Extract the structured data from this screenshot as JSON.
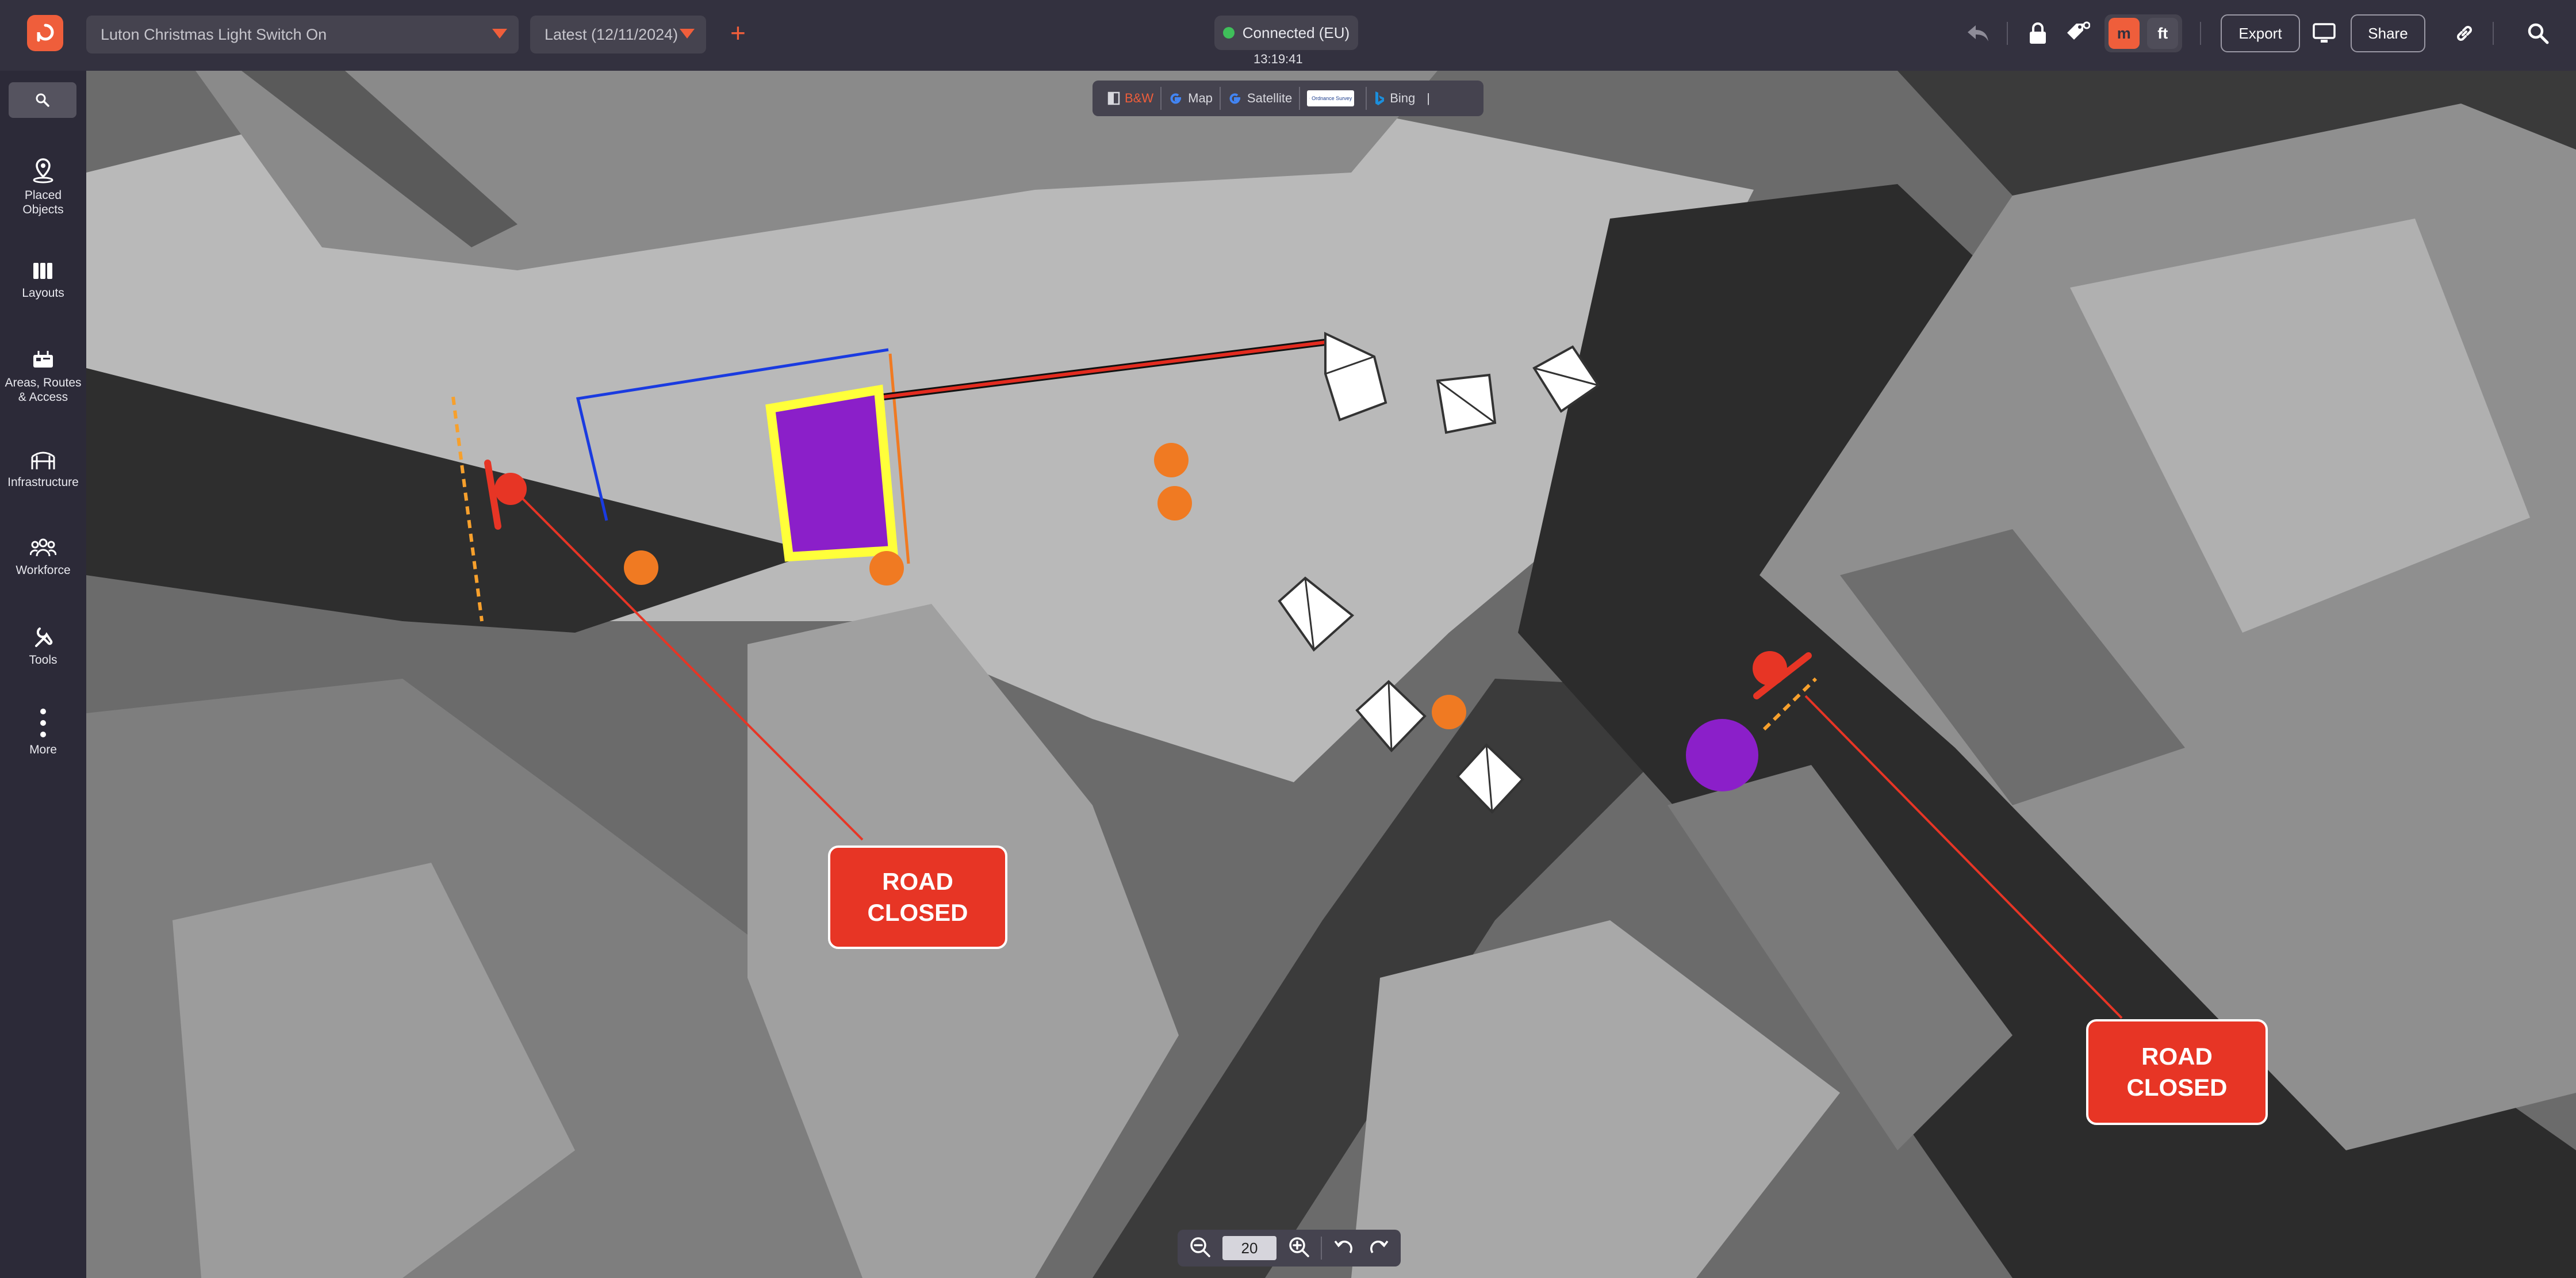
{
  "header": {
    "project_name": "Luton Christmas Light Switch On",
    "version": "Latest (12/11/2024)",
    "add_label": "+",
    "connection_status": "Connected (EU)",
    "clock": "13:19:41",
    "unit_m": "m",
    "unit_ft": "ft",
    "export_label": "Export",
    "share_label": "Share"
  },
  "sidebar": {
    "items": [
      {
        "label": "Placed\nObjects",
        "icon": "map-pin-icon"
      },
      {
        "label": "Layouts",
        "icon": "layouts-icon"
      },
      {
        "label": "Areas, Routes\n& Access",
        "icon": "routes-icon"
      },
      {
        "label": "Infrastructure",
        "icon": "infrastructure-icon"
      },
      {
        "label": "Workforce",
        "icon": "workforce-icon"
      },
      {
        "label": "Tools",
        "icon": "tools-icon"
      },
      {
        "label": "More",
        "icon": "more-vertical-icon"
      }
    ]
  },
  "map_layers": [
    {
      "label": "B&W",
      "active": true
    },
    {
      "label": "Map",
      "active": false
    },
    {
      "label": "Satellite",
      "active": false
    },
    {
      "label": "Ordnance Survey",
      "active": false
    },
    {
      "label": "Bing",
      "active": false
    }
  ],
  "zoom": {
    "value": "20"
  },
  "annotations": {
    "road_closed_1": "ROAD\nCLOSED",
    "road_closed_2": "ROAD\nCLOSED"
  },
  "colors": {
    "accent": "#ef5e3b",
    "topbar": "#33313f",
    "stage_fill": "#8b1fc9",
    "stage_outline": "#ffff3a",
    "road_closed": "#e73525",
    "barrier_line": "#1a3be0"
  }
}
